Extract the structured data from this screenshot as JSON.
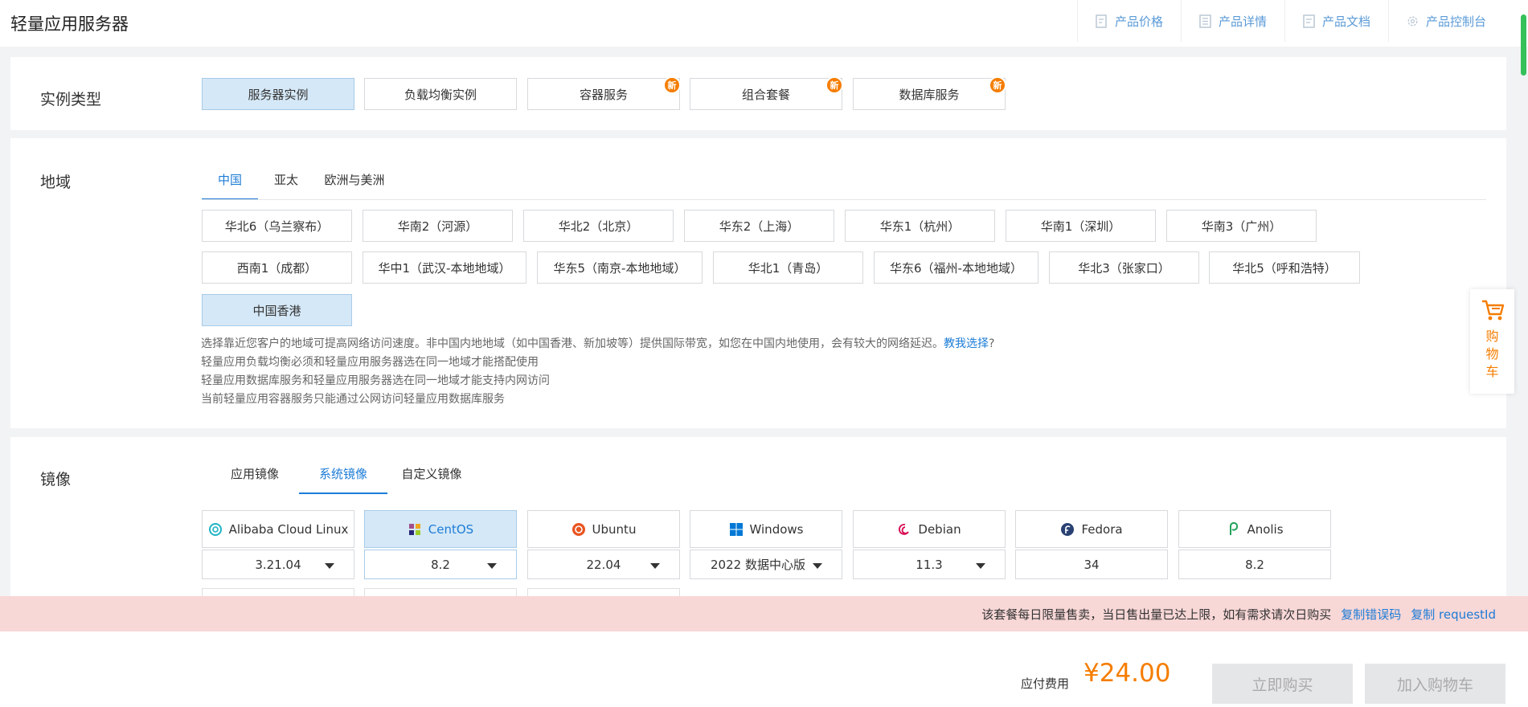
{
  "header": {
    "title": "轻量应用服务器",
    "links": [
      "产品价格",
      "产品详情",
      "产品文档",
      "产品控制台"
    ]
  },
  "instance_type": {
    "label": "实例类型",
    "options": [
      "服务器实例",
      "负载均衡实例",
      "容器服务",
      "组合套餐",
      "数据库服务"
    ],
    "badge": "新"
  },
  "region": {
    "label": "地域",
    "tabs": [
      "中国",
      "亚太",
      "欧洲与美洲"
    ],
    "items": [
      "华北6（乌兰察布）",
      "华南2（河源）",
      "华北2（北京）",
      "华东2（上海）",
      "华东1（杭州）",
      "华南1（深圳）",
      "华南3（广州）",
      "西南1（成都）",
      "华中1（武汉-本地地域）",
      "华东5（南京-本地地域）",
      "华北1（青岛）",
      "华东6（福州-本地地域）",
      "华北3（张家口）",
      "华北5（呼和浩特）",
      "中国香港"
    ],
    "tip1": "选择靠近您客户的地域可提高网络访问速度。非中国内地地域（如中国香港、新加坡等）提供国际带宽，如您在中国内地使用，会有较大的网络延迟。",
    "tip1_link": "教我选择",
    "tip1_tail": "?",
    "tip2": "轻量应用负载均衡必须和轻量应用服务器选在同一地域才能搭配使用",
    "tip3": "轻量应用数据库服务和轻量应用服务器选在同一地域才能支持内网访问",
    "tip4": "当前轻量应用容器服务只能通过公网访问轻量应用数据库服务"
  },
  "image": {
    "label": "镜像",
    "tabs": [
      "应用镜像",
      "系统镜像",
      "自定义镜像"
    ],
    "os": [
      {
        "name": "Alibaba Cloud Linux",
        "version": "3.21.04"
      },
      {
        "name": "CentOS",
        "version": "8.2"
      },
      {
        "name": "Ubuntu",
        "version": "22.04"
      },
      {
        "name": "Windows",
        "version": "2022 数据中心版"
      },
      {
        "name": "Debian",
        "version": "11.3"
      },
      {
        "name": "Fedora",
        "version": "34"
      },
      {
        "name": "Anolis",
        "version": "8.2"
      }
    ]
  },
  "error": {
    "message": "该套餐每日限量售卖，当日售出量已达上限，如有需求请次日购买",
    "copy_code": "复制错误码",
    "copy_request": "复制 requestId"
  },
  "footer": {
    "fee_label": "应付费用",
    "price": "¥24.00",
    "buy_now": "立即购买",
    "add_cart": "加入购物车"
  },
  "cart": {
    "label": "购物车"
  },
  "colors": {
    "accent": "#1c7cd6",
    "orange": "#f57d00",
    "selected_bg": "#d5e8f7",
    "error_bg": "#f8d7d7"
  }
}
